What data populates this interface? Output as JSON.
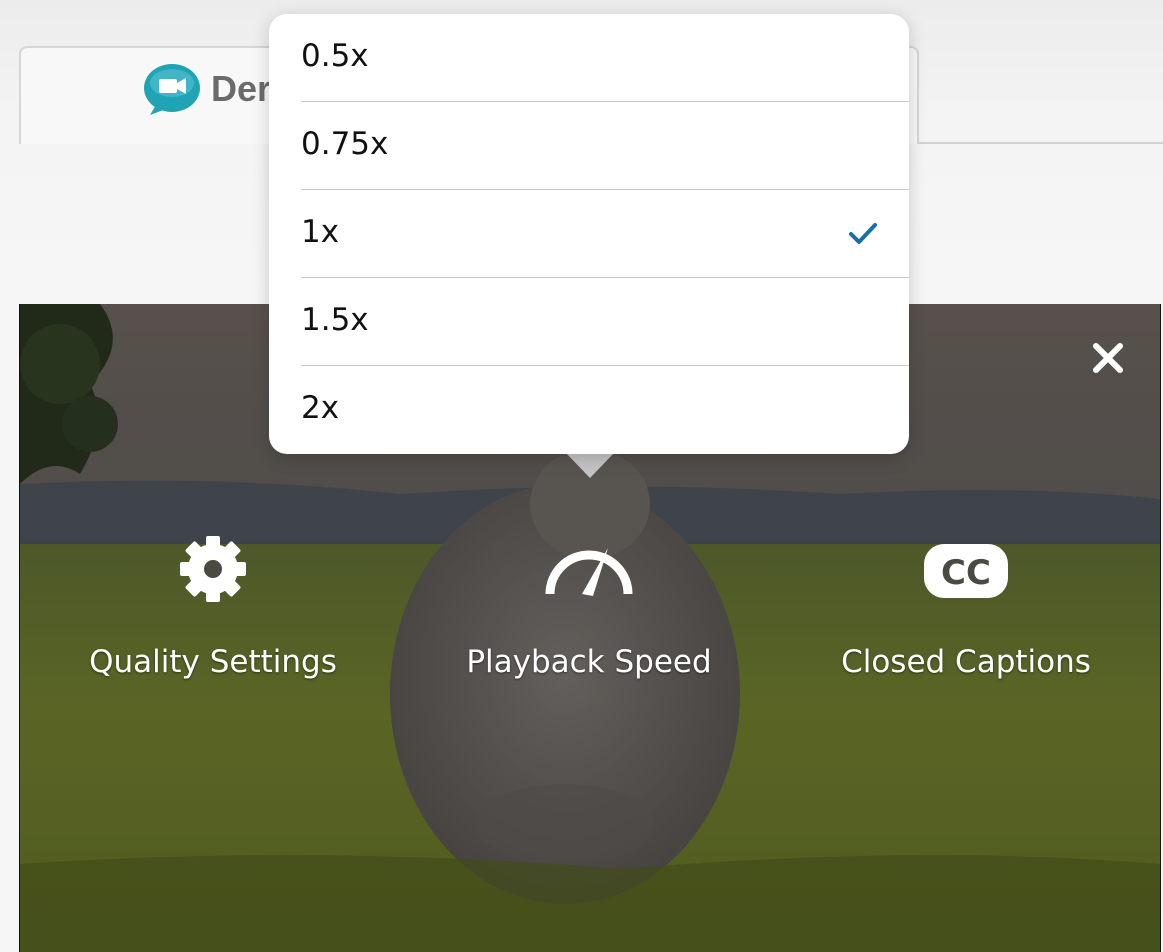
{
  "tab": {
    "title_partial": "Der",
    "logo_icon": "video-chat-bubble-icon"
  },
  "speed_menu": {
    "options": [
      {
        "label": "0.5x",
        "selected": false
      },
      {
        "label": "0.75x",
        "selected": false
      },
      {
        "label": "1x",
        "selected": true
      },
      {
        "label": "1.5x",
        "selected": false
      },
      {
        "label": "2x",
        "selected": false
      }
    ],
    "check_color": "#1a6fa8"
  },
  "player_settings": {
    "close_icon": "close-icon",
    "quality": {
      "label": "Quality Settings",
      "icon": "gear-icon"
    },
    "speed": {
      "label": "Playback Speed",
      "icon": "speedometer-icon"
    },
    "captions": {
      "label": "Closed Captions",
      "icon": "cc-icon"
    }
  },
  "colors": {
    "logo": "#1fa3b5",
    "overlay_text": "#ffffff"
  }
}
